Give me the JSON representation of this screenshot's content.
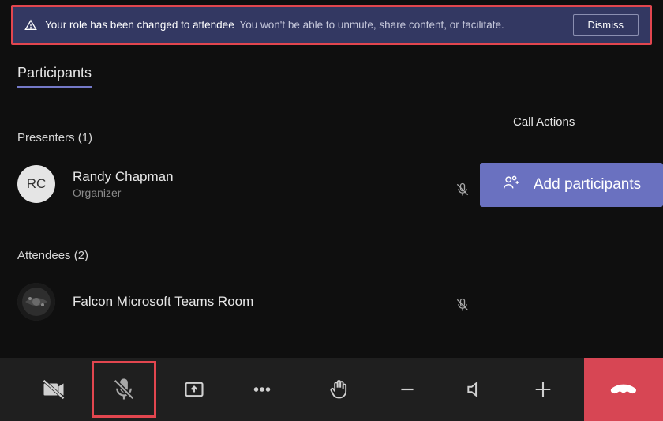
{
  "notification": {
    "title": "Your role has been changed to attendee",
    "message": "You won't be able to unmute, share content, or facilitate.",
    "dismiss_label": "Dismiss"
  },
  "participants_title": "Participants",
  "call_actions_title": "Call Actions",
  "presenters": {
    "label": "Presenters (1)",
    "items": [
      {
        "initials": "RC",
        "name": "Randy Chapman",
        "role": "Organizer"
      }
    ]
  },
  "attendees": {
    "label": "Attendees (2)",
    "items": [
      {
        "name": "Falcon Microsoft Teams Room"
      }
    ]
  },
  "add_participants_label": "Add participants",
  "colors": {
    "accent": "#6a71c0",
    "notification_bg": "#333862",
    "highlight": "#e2464f",
    "hangup": "#d74654"
  }
}
